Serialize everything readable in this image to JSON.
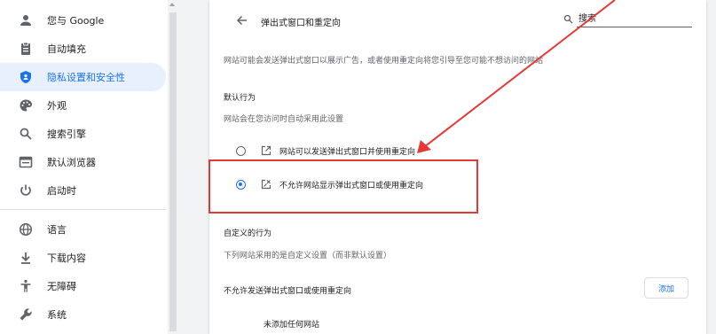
{
  "sidebar": {
    "items": [
      {
        "label": "您与 Google",
        "icon": "person-icon"
      },
      {
        "label": "自动填充",
        "icon": "clipboard-icon"
      },
      {
        "label": "隐私设置和安全性",
        "icon": "shield-icon",
        "selected": true
      },
      {
        "label": "外观",
        "icon": "palette-icon"
      },
      {
        "label": "搜索引擎",
        "icon": "search-icon"
      },
      {
        "label": "默认浏览器",
        "icon": "browser-icon"
      },
      {
        "label": "启动时",
        "icon": "power-icon"
      },
      {
        "label": "语言",
        "icon": "globe-icon"
      },
      {
        "label": "下载内容",
        "icon": "download-icon"
      },
      {
        "label": "无障碍",
        "icon": "accessibility-icon"
      },
      {
        "label": "系统",
        "icon": "wrench-icon"
      }
    ]
  },
  "header": {
    "title": "弹出式窗口和重定向",
    "search_placeholder": "搜索"
  },
  "main": {
    "description": "网站可能会发送弹出式窗口以展示广告，或者使用重定向将您引导至您可能不想访问的网站",
    "default_behavior": {
      "heading": "默认行为",
      "subheading": "网站会在您访问时自动采用此设置",
      "options": [
        {
          "label": "网站可以发送弹出式窗口并使用重定向",
          "icon": "open-in-new-icon",
          "selected": false
        },
        {
          "label": "不允许网站显示弹出式窗口或使用重定向",
          "icon": "popup-blocked-icon",
          "selected": true
        }
      ]
    },
    "custom_behavior": {
      "heading": "自定义的行为",
      "subheading": "下列网站采用的是自定义设置（而非默认设置）",
      "block_list_label": "不允许发送弹出式窗口或使用重定向",
      "add_button": "添加",
      "empty_note": "未添加任何网站"
    }
  },
  "colors": {
    "accent": "#1a73e8",
    "selected_bg": "#e8f0fe",
    "annotation": "#e53935"
  }
}
